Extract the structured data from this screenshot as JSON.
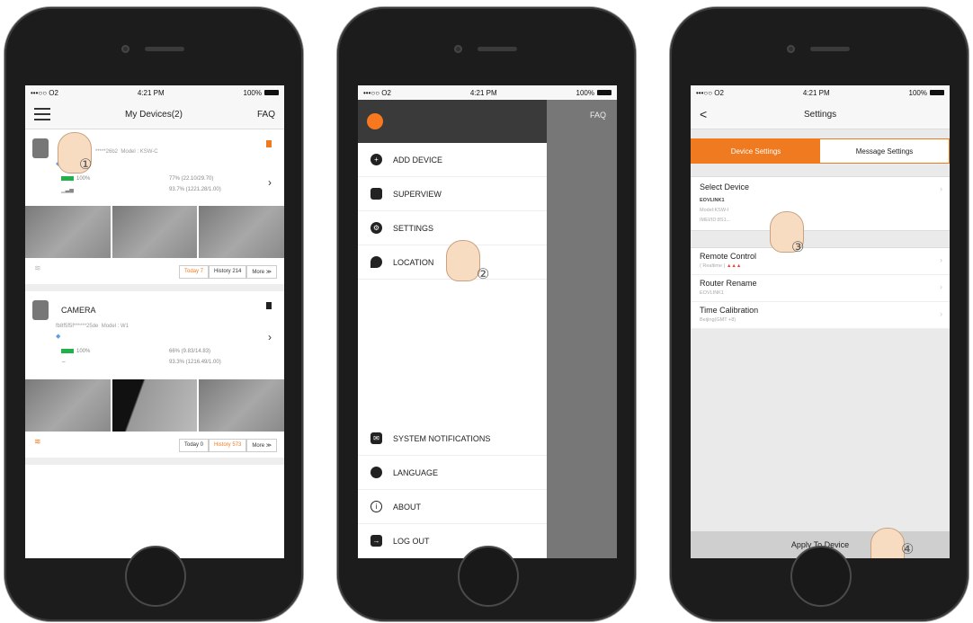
{
  "status": {
    "carrier": "•••○○ O2",
    "time": "4:21 PM",
    "battery": "100%"
  },
  "phone1": {
    "nav_title": "My Devices(2)",
    "nav_faq": "FAQ",
    "device1": {
      "id_text": "*****26b2",
      "model_text": "Model : KSW-C",
      "battery": "100%",
      "sd": "77% (22.10/29.70)",
      "cloud": "93.7% (1221.28/1.00)",
      "tab_today": "Today 7",
      "tab_history": "History 214",
      "tab_more": "More ≫"
    },
    "device2": {
      "name": "CAMERA",
      "id_text": "fb8f5f5f******25de",
      "model_text": "Model : W1",
      "battery": "100%",
      "sd": "66% (9.83/14.83)",
      "cloud": "93.3% (1216.49/1.00)",
      "tab_today": "Today 0",
      "tab_history": "History 573",
      "tab_more": "More ≫"
    },
    "step": "①"
  },
  "phone2": {
    "faq": "FAQ",
    "menu": [
      "ADD DEVICE",
      "SUPERVIEW",
      "SETTINGS",
      "LOCATION"
    ],
    "bottom_menu": [
      "SYSTEM NOTIFICATIONS",
      "LANGUAGE",
      "ABOUT",
      "LOG OUT"
    ],
    "step": "②"
  },
  "phone3": {
    "back": "<",
    "title": "Settings",
    "tab_device": "Device Settings",
    "tab_message": "Message Settings",
    "select_device": "Select Device",
    "device_name": "EOVLINK1",
    "device_model": "Model:KSW-I",
    "device_ip": "IMEI/ID:8S1...",
    "rows": [
      {
        "title": "Remote Control",
        "sub": "( Realtime )"
      },
      {
        "title": "Router Rename",
        "sub": "EOVLINK1"
      },
      {
        "title": "Time Calibration",
        "sub": "Beijing(GMT +8)"
      }
    ],
    "apply": "Apply To Device",
    "step3": "③",
    "step4": "④"
  }
}
